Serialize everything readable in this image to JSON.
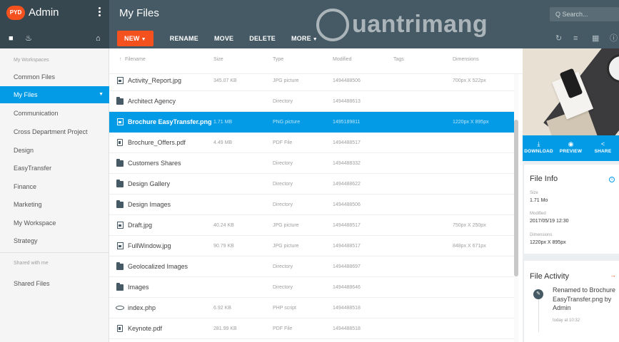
{
  "app": {
    "logo_text": "PYD",
    "title": "Admin"
  },
  "header": {
    "page_title": "My Files",
    "search_placeholder": "Q Search...",
    "watermark": "uantrimang"
  },
  "toolbar": {
    "new_label": "NEW",
    "rename_label": "RENAME",
    "move_label": "MOVE",
    "delete_label": "DELETE",
    "more_label": "MORE"
  },
  "sidebar": {
    "workspaces_label": "My Workspaces",
    "items": [
      {
        "label": "Common Files"
      },
      {
        "label": "My Files"
      },
      {
        "label": "Communication"
      },
      {
        "label": "Cross Department Project"
      },
      {
        "label": "Design"
      },
      {
        "label": "EasyTransfer"
      },
      {
        "label": "Finance"
      },
      {
        "label": "Marketing"
      },
      {
        "label": "My Workspace"
      },
      {
        "label": "Strategy"
      }
    ],
    "shared_label": "Shared with me",
    "shared_items": [
      {
        "label": "Shared Files"
      }
    ]
  },
  "table": {
    "columns": {
      "filename": "Filename",
      "size": "Size",
      "type": "Type",
      "modified": "Modified",
      "tags": "Tags",
      "dimensions": "Dimensions"
    },
    "rows": [
      {
        "icon": "image-icon",
        "name": "Activity_Report.jpg",
        "size": "345.07 KB",
        "type": "JPG picture",
        "modified": "1494488506",
        "dimensions": "700px X 522px"
      },
      {
        "icon": "folder-icon",
        "name": "Architect Agency",
        "size": "",
        "type": "Directory",
        "modified": "1494488613",
        "dimensions": ""
      },
      {
        "icon": "image-icon",
        "name": "Brochure EasyTransfer.png",
        "size": "1.71 MB",
        "type": "PNG picture",
        "modified": "1495189811",
        "dimensions": "1220px X 895px"
      },
      {
        "icon": "document-icon",
        "name": "Brochure_Offers.pdf",
        "size": "4.49 MB",
        "type": "PDF File",
        "modified": "1494488517",
        "dimensions": ""
      },
      {
        "icon": "folder-icon",
        "name": "Customers Shares",
        "size": "",
        "type": "Directory",
        "modified": "1494488332",
        "dimensions": ""
      },
      {
        "icon": "folder-icon",
        "name": "Design Gallery",
        "size": "",
        "type": "Directory",
        "modified": "1494488622",
        "dimensions": ""
      },
      {
        "icon": "folder-icon",
        "name": "Design Images",
        "size": "",
        "type": "Directory",
        "modified": "1494488506",
        "dimensions": ""
      },
      {
        "icon": "image-icon",
        "name": "Draft.jpg",
        "size": "40.24 KB",
        "type": "JPG picture",
        "modified": "1494488517",
        "dimensions": "750px X 250px"
      },
      {
        "icon": "image-icon",
        "name": "FullWindow.jpg",
        "size": "90.79 KB",
        "type": "JPG picture",
        "modified": "1494488517",
        "dimensions": "848px X 671px"
      },
      {
        "icon": "folder-icon",
        "name": "Geolocalized Images",
        "size": "",
        "type": "Directory",
        "modified": "1494488697",
        "dimensions": ""
      },
      {
        "icon": "folder-icon",
        "name": "Images",
        "size": "",
        "type": "Directory",
        "modified": "1494488646",
        "dimensions": ""
      },
      {
        "icon": "code-icon",
        "name": "index.php",
        "size": "6.92 KB",
        "type": "PHP script",
        "modified": "1494488518",
        "dimensions": ""
      },
      {
        "icon": "document-icon",
        "name": "Keynote.pdf",
        "size": "281.99 KB",
        "type": "PDF File",
        "modified": "1494488518",
        "dimensions": ""
      }
    ]
  },
  "details": {
    "actions": {
      "download": "DOWNLOAD",
      "preview": "PREVIEW",
      "share": "SHARE"
    },
    "info": {
      "title": "File Info",
      "size_label": "Size",
      "size_value": "1.71 Mo",
      "modified_label": "Modified",
      "modified_value": "2017/05/19 12:30",
      "dimensions_label": "Dimensions",
      "dimensions_value": "1220px X 895px"
    },
    "activity": {
      "title": "File Activity",
      "entry_text": "Renamed to Brochure EasyTransfer.png by Admin",
      "entry_time": "today at 10:32"
    }
  },
  "colors": {
    "accent": "#039be5",
    "new_button": "#f4511e",
    "header_dark": "#36474f",
    "header": "#455a64"
  }
}
